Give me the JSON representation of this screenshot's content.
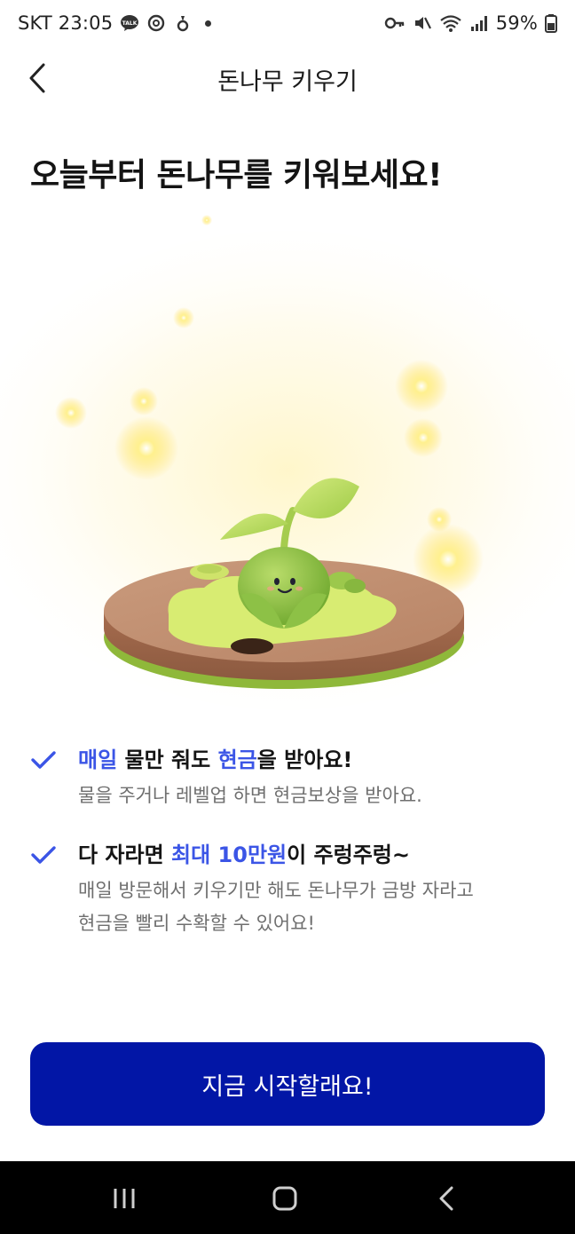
{
  "status_bar": {
    "carrier_time": "SKT 23:05",
    "battery": "59%",
    "left_icons": [
      "talk-icon",
      "threads-icon",
      "app-icon",
      "dot-icon"
    ],
    "right_icons": [
      "key-icon",
      "mute-icon",
      "wifi-icon",
      "signal-icon",
      "battery-icon"
    ]
  },
  "topbar": {
    "title": "돈나무 키우기"
  },
  "headline": "오늘부터 돈나무를 키워보세요!",
  "benefits": [
    {
      "title_parts": [
        "매일",
        " 물만 줘도 ",
        "현금",
        "을 받아요!"
      ],
      "desc": "물을 주거나 레벨업 하면 현금보상을 받아요."
    },
    {
      "title_parts": [
        "다 자라면 ",
        "최대 10만원",
        "이 주렁주렁~"
      ],
      "desc_lines": [
        "매일 방문해서 키우기만 해도 돈나무가 금방 자라고",
        "현금을 빨리 수확할 수 있어요!"
      ]
    }
  ],
  "cta": {
    "label": "지금 시작할래요!"
  },
  "colors": {
    "accent": "#3b55e6",
    "cta_bg": "#0216a6",
    "nav_bg": "#000000"
  }
}
